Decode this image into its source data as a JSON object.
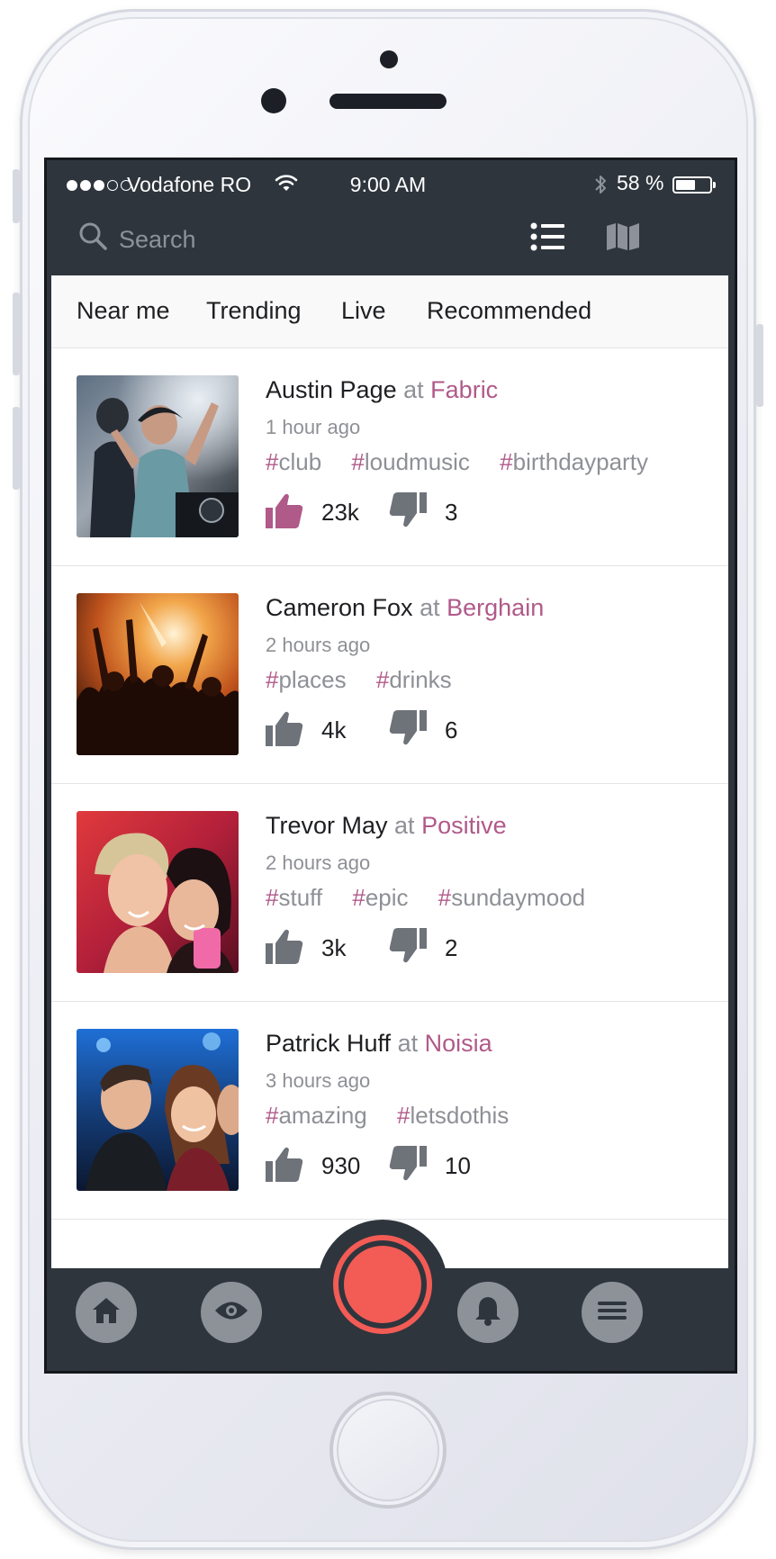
{
  "status_bar": {
    "carrier": "Vodafone RO",
    "time": "9:00 AM",
    "battery_percent": "58 %",
    "battery_level": 0.58,
    "signal_bars_filled": 3,
    "signal_bars_total": 5
  },
  "search": {
    "placeholder": "Search"
  },
  "tabs": [
    {
      "label": "Near me"
    },
    {
      "label": "Trending"
    },
    {
      "label": "Live"
    },
    {
      "label": "Recommended"
    }
  ],
  "posts": [
    {
      "author": "Austin Page",
      "at": "at",
      "venue": "Fabric",
      "time": "1 hour ago",
      "tags": [
        "club",
        "loudmusic",
        "birthdayparty"
      ],
      "likes": "23k",
      "dislikes": "3",
      "liked": true
    },
    {
      "author": "Cameron Fox",
      "at": "at",
      "venue": "Berghain",
      "time": "2 hours ago",
      "tags": [
        "places",
        "drinks"
      ],
      "likes": "4k",
      "dislikes": "6",
      "liked": false
    },
    {
      "author": "Trevor May",
      "at": "at",
      "venue": "Positive",
      "time": "2 hours ago",
      "tags": [
        "stuff",
        "epic",
        "sundaymood"
      ],
      "likes": "3k",
      "dislikes": "2",
      "liked": false
    },
    {
      "author": "Patrick Huff",
      "at": "at",
      "venue": "Noisia",
      "time": "3 hours ago",
      "tags": [
        "amazing",
        "letsdothis"
      ],
      "likes": "930",
      "dislikes": "10",
      "liked": false
    }
  ],
  "colors": {
    "accent": "#b05a8a",
    "dark_bar": "#2e353d",
    "record": "#f35b55",
    "icon_grey": "#8d9299",
    "like_active": "#b05a8a",
    "like_inactive": "#6e7279"
  },
  "icons": {
    "search": "search-icon",
    "list_view": "list-view-icon",
    "map_view": "map-view-icon",
    "like": "thumbs-up-icon",
    "dislike": "thumbs-down-icon",
    "home": "home-icon",
    "eye": "eye-icon",
    "record": "record-icon",
    "bell": "bell-icon",
    "menu": "menu-icon"
  }
}
